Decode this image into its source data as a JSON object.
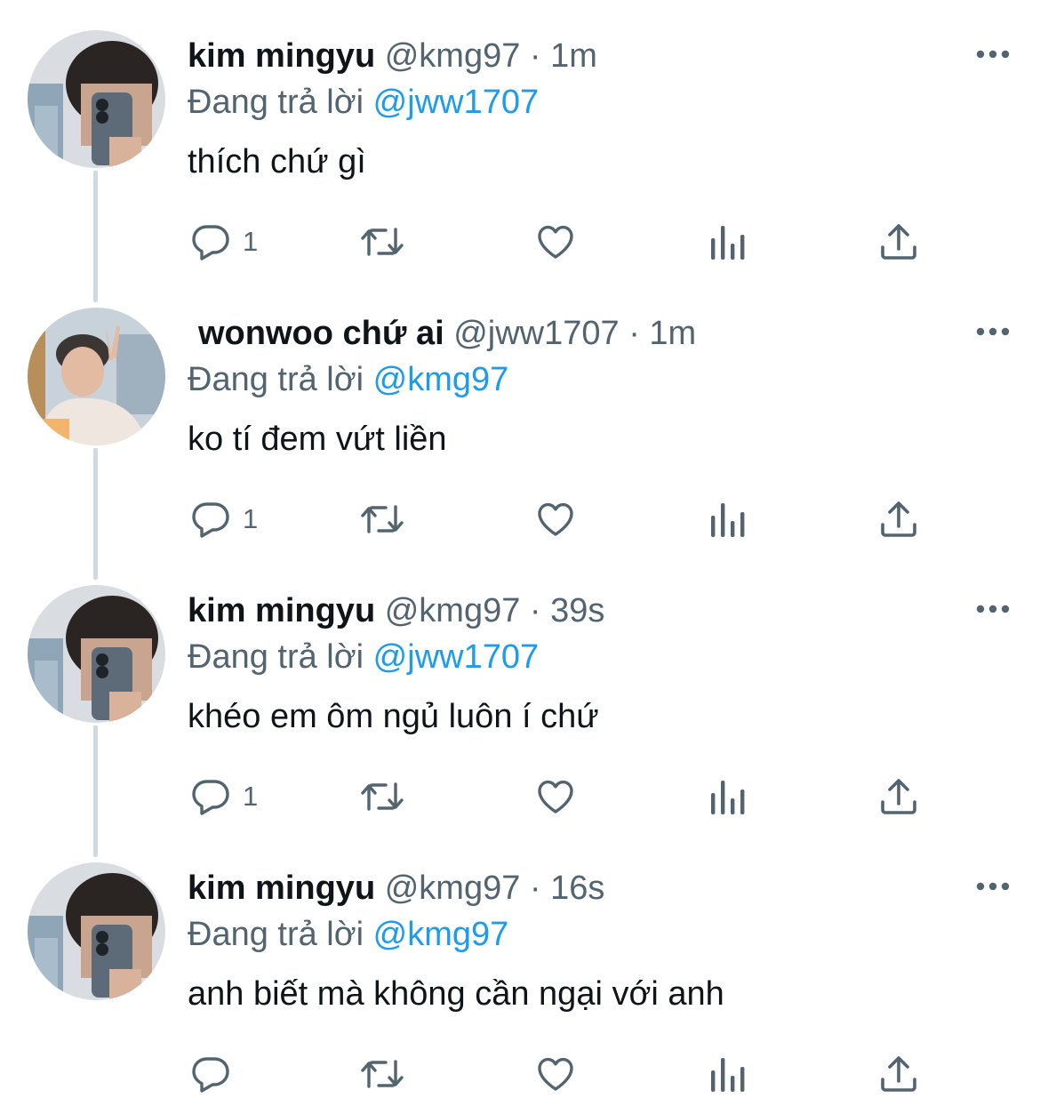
{
  "colors": {
    "text": "#0f1419",
    "secondary": "#536471",
    "mention": "#1d9bf0",
    "thread_line": "#cfd9de"
  },
  "icons": {
    "more": "more-horizontal-icon",
    "reply": "reply-icon",
    "retweet": "retweet-icon",
    "like": "heart-icon",
    "views": "views-icon",
    "share": "share-icon"
  },
  "tweets": [
    {
      "name": "kim mingyu",
      "handle": "@kmg97",
      "separator": "·",
      "time": "1m",
      "reply_prefix": "Đang trả lời",
      "reply_to": "@jww1707",
      "text": "thích chứ gì",
      "reply_count": "1"
    },
    {
      "name": "wonwoo chứ ai",
      "handle": "@jww1707",
      "separator": "·",
      "time": "1m",
      "reply_prefix": "Đang trả lời",
      "reply_to": "@kmg97",
      "text": "ko tí đem vứt liền",
      "reply_count": "1"
    },
    {
      "name": "kim mingyu",
      "handle": "@kmg97",
      "separator": "·",
      "time": "39s",
      "reply_prefix": "Đang trả lời",
      "reply_to": "@jww1707",
      "text": "khéo em ôm ngủ luôn í chứ",
      "reply_count": "1"
    },
    {
      "name": "kim mingyu",
      "handle": "@kmg97",
      "separator": "·",
      "time": "16s",
      "reply_prefix": "Đang trả lời",
      "reply_to": "@kmg97",
      "text": "anh biết mà không cần ngại với anh",
      "reply_count": ""
    }
  ]
}
